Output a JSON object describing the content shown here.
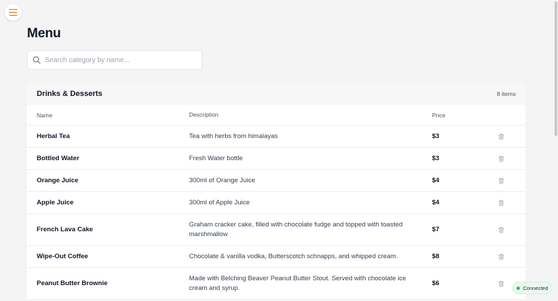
{
  "page": {
    "title": "Menu"
  },
  "search": {
    "placeholder": "Search category by name...",
    "value": ""
  },
  "category": {
    "title": "Drinks & Desserts",
    "item_count": "8 items"
  },
  "table": {
    "headers": {
      "name": "Name",
      "description": "Description",
      "price": "Price"
    },
    "rows": [
      {
        "name": "Herbal Tea",
        "description": "Tea with herbs from himalayas",
        "price": "$3"
      },
      {
        "name": "Bottled Water",
        "description": "Fresh Water bottle",
        "price": "$3"
      },
      {
        "name": "Orange Juice",
        "description": "300ml of Orange Juice",
        "price": "$4"
      },
      {
        "name": "Apple Juice",
        "description": "300ml of Apple Juice",
        "price": "$4"
      },
      {
        "name": "French Lava Cake",
        "description": "Graham cracker cake, filled with chocolate fudge and topped with toasted marshmallow",
        "price": "$7"
      },
      {
        "name": "Wipe-Out Coffee",
        "description": "Chocolate & vanilla vodka, Butterscotch schnapps, and whipped cream.",
        "price": "$8"
      },
      {
        "name": "Peanut Butter Brownie",
        "description": "Made with Belching Beaver Peanut Butter Stout. Served with chocolate ice cream and syrup.",
        "price": "$6"
      }
    ]
  },
  "connection": {
    "status": "Connected"
  },
  "colors": {
    "accent": "#e8833a",
    "connected": "#22c55e"
  },
  "icons": {
    "menu": "hamburger-icon",
    "search": "search-icon",
    "delete": "trash-icon",
    "status": "status-dot-icon"
  }
}
